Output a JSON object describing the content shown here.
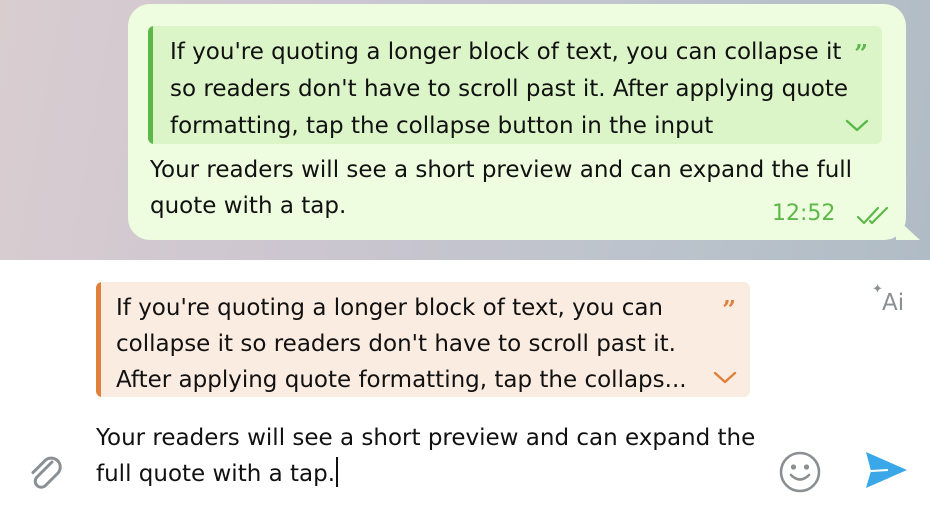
{
  "message": {
    "quote": {
      "text": "If you're quoting a longer block of text, you can collapse it so readers don't have to scroll past it. After applying quote formatting, tap the collapse button in the input",
      "icon": "quote-icon",
      "toggle_icon": "chevron-down-icon"
    },
    "text": "Your readers will see a short preview and can expand the full quote with a tap.",
    "time": "12:52",
    "status_icon": "double-check-icon"
  },
  "composer": {
    "reply_quote": {
      "text": "If you're quoting a longer block of text, you can collapse it so readers don't have to scroll past it. After applying quote formatting, tap the collaps...",
      "icon": "quote-icon",
      "toggle_icon": "chevron-down-icon"
    },
    "ai_button_label": "Ai",
    "input_value": "Your readers will see a short preview and can expand the full quote with a tap.",
    "icons": {
      "attach": "paperclip-icon",
      "emoji": "smiley-icon",
      "send": "send-icon"
    }
  },
  "colors": {
    "outgoing_bubble": "#eefcdf",
    "outgoing_accent": "#5db84a",
    "quote_accent": "#e0803a",
    "quote_background": "#fbece2",
    "send_accent": "#3aa8e8"
  }
}
